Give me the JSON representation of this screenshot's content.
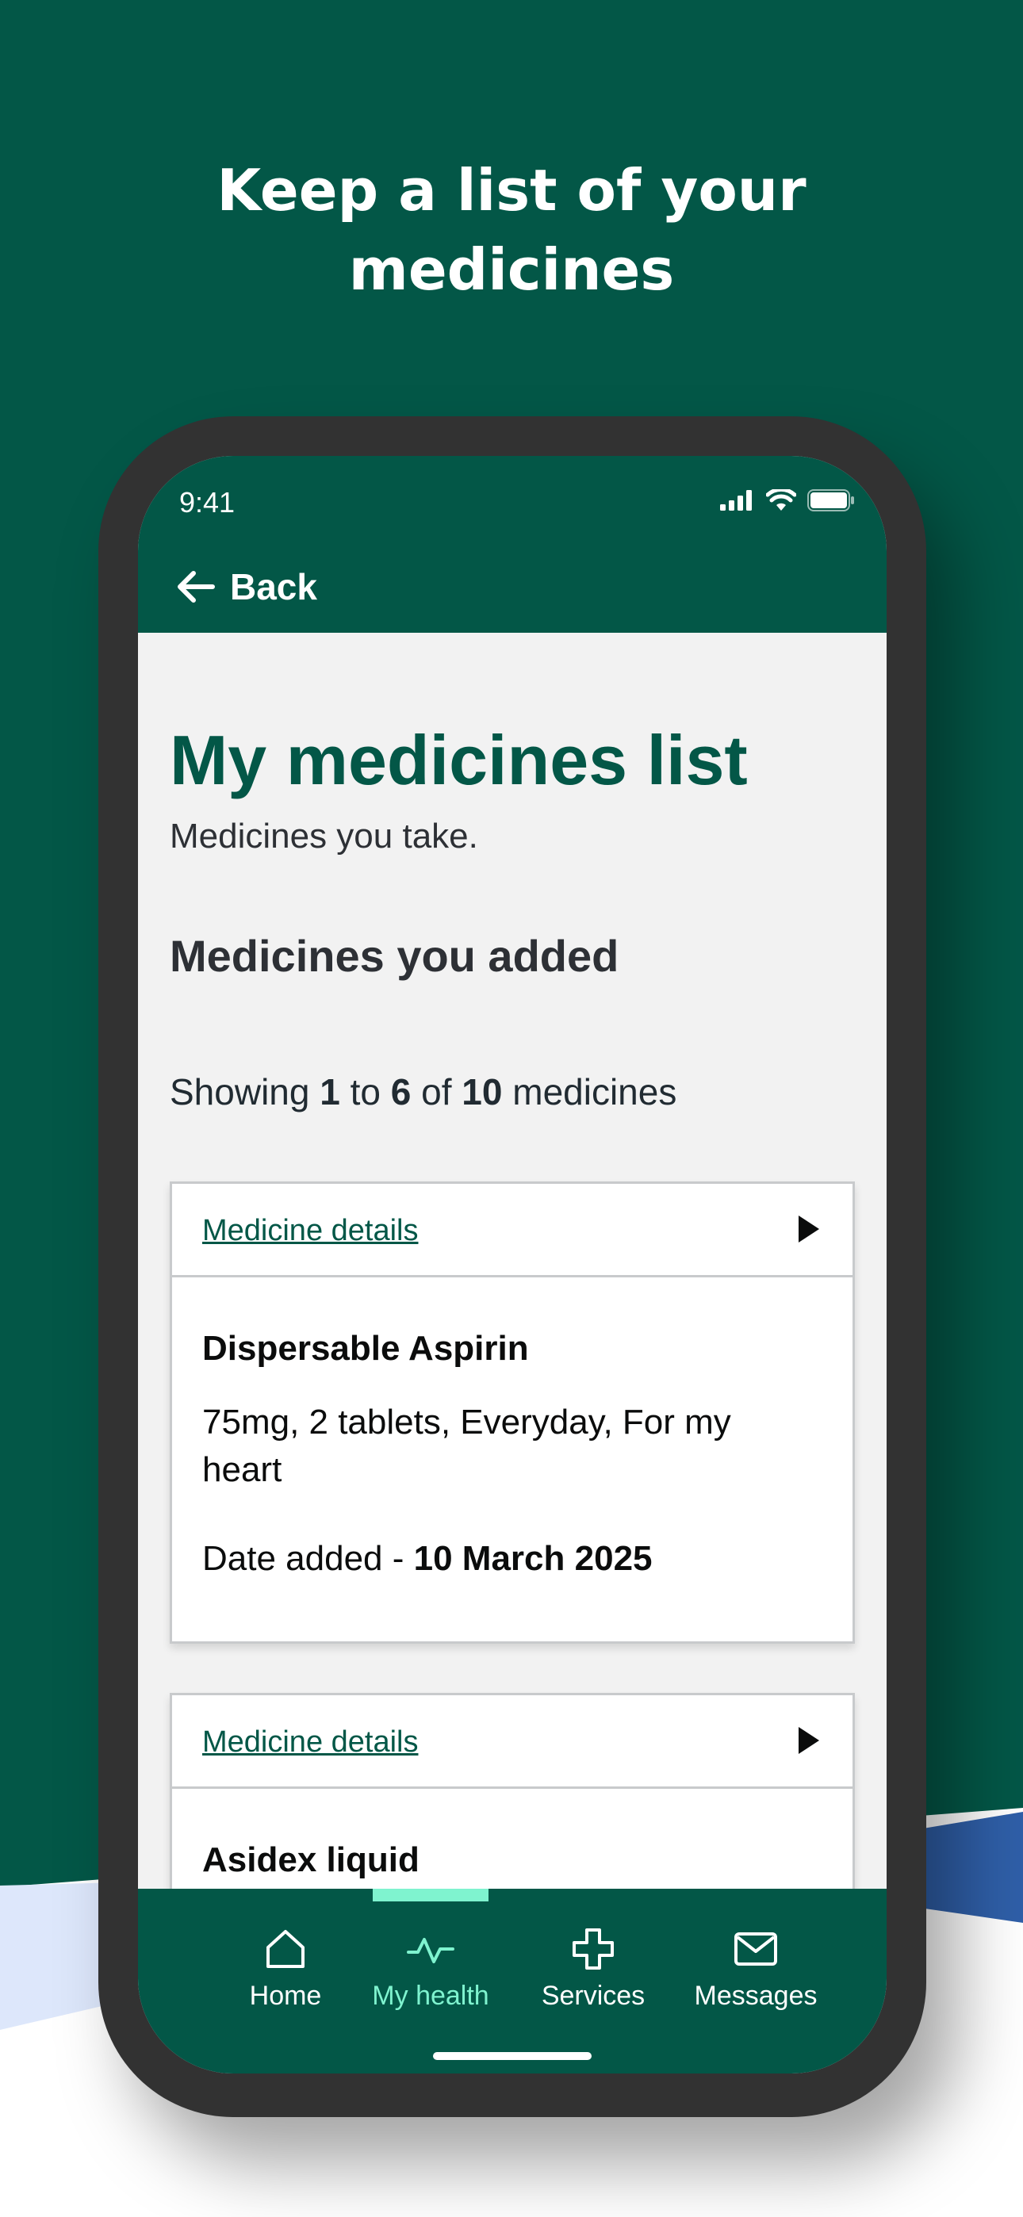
{
  "headline": {
    "line1": "Keep a list of your",
    "line2": "medicines"
  },
  "status_bar": {
    "time": "9:41",
    "icons": [
      "signal-icon",
      "wifi-icon",
      "battery-icon"
    ]
  },
  "app_bar": {
    "back_label": "Back",
    "back_icon": "arrow-left-icon"
  },
  "page": {
    "title": "My medicines list",
    "subtitle": "Medicines you take.",
    "section_title": "Medicines you added",
    "showing": {
      "prefix": "Showing",
      "from": "1",
      "to_word": "to",
      "to": "6",
      "of_word": "of",
      "total": "10",
      "suffix": "medicines"
    }
  },
  "cards": [
    {
      "link": "Medicine details",
      "name": "Dispersable Aspirin",
      "description": "75mg, 2 tablets, Everyday, For my heart",
      "date_label": "Date added -",
      "date_value": "10 March 2025"
    },
    {
      "link": "Medicine details",
      "name": "Asidex liquid"
    }
  ],
  "tabs": [
    {
      "label": "Home",
      "icon": "home-icon",
      "active": false
    },
    {
      "label": "My health",
      "icon": "pulse-icon",
      "active": true
    },
    {
      "label": "Services",
      "icon": "plus-cross-icon",
      "active": false
    },
    {
      "label": "Messages",
      "icon": "envelope-icon",
      "active": false
    }
  ],
  "colors": {
    "brand_green": "#035747",
    "accent_mint": "#7ff3cf",
    "page_background": "#f2f2f2"
  }
}
